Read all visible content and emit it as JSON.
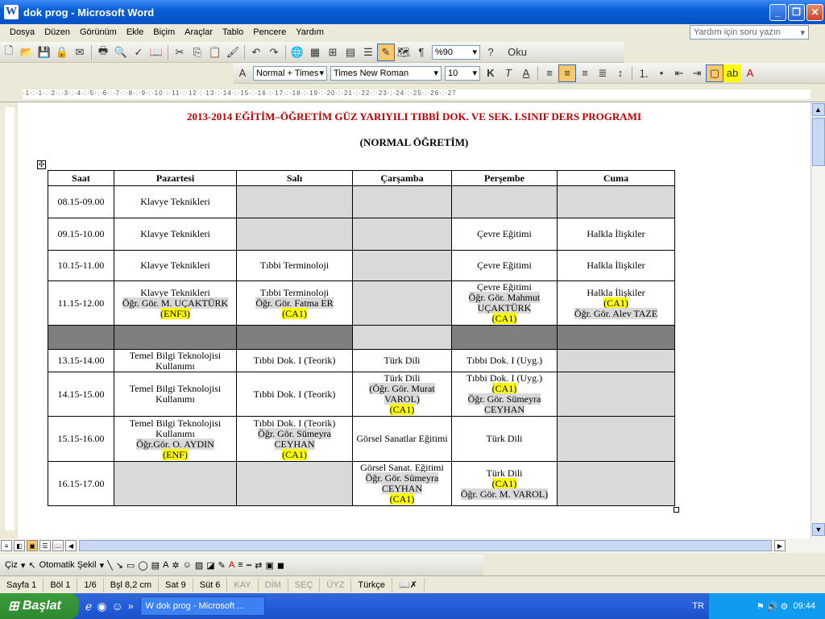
{
  "window": {
    "title": "dok prog - Microsoft Word",
    "icon_letter": "W"
  },
  "menu": [
    "Dosya",
    "Düzen",
    "Görünüm",
    "Ekle",
    "Biçim",
    "Araçlar",
    "Tablo",
    "Pencere",
    "Yardım"
  ],
  "help_placeholder": "Yardım için soru yazın",
  "toolbar": {
    "zoom": "%90",
    "read_label": "Oku",
    "style": "Normal + Times",
    "font": "Times New Roman",
    "size": "10"
  },
  "ruler_text": "·1·:·1·:·2·:·3·:·4·:·5·:·6·:·7·:·8·:·9·:·10·:·11·:·12·:·13·:·14·:·15·:·16·:·17·:·18·:·19·:·20·:·21·:·22·:·23·:·24·:·25·:·26·:·27",
  "document": {
    "title": "2013-2014 EĞİTİM–ÖĞRETİM GÜZ YARIYILI TIBBİ DOK. VE SEK. I.SINIF DERS PROGRAMI",
    "subtitle": "(NORMAL ÖĞRETİM)",
    "headers": [
      "Saat",
      "Pazartesi",
      "Salı",
      "Çarşamba",
      "Perşembe",
      "Cuma"
    ],
    "rows": [
      {
        "time": "08.15-09.00",
        "mon": "Klavye Teknikleri"
      },
      {
        "time": "09.15-10.00",
        "mon": "Klavye Teknikleri",
        "thu": "Çevre Eğitimi",
        "fri": "Halkla İlişkiler"
      },
      {
        "time": "10.15-11.00",
        "mon": "Klavye Teknikleri",
        "tue": "Tıbbi Terminoloji",
        "thu": "Çevre Eğitimi",
        "fri": "Halkla İlişkiler"
      },
      {
        "time": "11.15-12.00",
        "mon": {
          "l1": "Klavye Teknikleri",
          "l2": "Öğr. Gör. M. UÇAKTÜRK",
          "l3": "(ENF3)"
        },
        "tue": {
          "l1": "Tıbbi Terminoloji",
          "l2": "Öğr. Gör. Fatma ER",
          "l3": "(CA1)"
        },
        "thu": {
          "l1": "Çevre Eğitimi",
          "l2": "Öğr. Gör. Mahmut",
          "l3": "UÇAKTÜRK",
          "l4": "(CA1)"
        },
        "fri": {
          "l1": "Halkla İlişkiler",
          "l2": "(CA1)",
          "l3": "Öğr. Gör. Alev TAZE"
        }
      },
      {
        "time": "13.15-14.00",
        "mon": "Temel Bilgi Teknolojisi Kullanımı",
        "tue": "Tıbbi Dok. I  (Teorik)",
        "wed": "Türk Dili",
        "thu": "Tıbbi Dok. I  (Uyg.)"
      },
      {
        "time": "14.15-15.00",
        "mon": "Temel Bilgi Teknolojisi Kullanımı",
        "tue": "Tıbbi Dok. I (Teorik)",
        "wed": {
          "l1": "Türk Dili",
          "l2": "(Öğr. Gör. Murat",
          "l3": "VAROL)",
          "l4": "(CA1)"
        },
        "thu": {
          "l1": "Tıbbi Dok. I  (Uyg.)",
          "l2": "(CA1)",
          "l3": "Öğr. Gör.  Sümeyra",
          "l4": "CEYHAN"
        }
      },
      {
        "time": "15.15-16.00",
        "mon": {
          "l1": "Temel Bilgi Teknolojisi",
          "l2": "Kullanımı",
          "l3": "Öğr.Gör. O. AYDIN",
          "l4": "(ENF)"
        },
        "tue": {
          "l1": "Tıbbi Dok. I (Teorik)",
          "l2": "Öğr. Gör. Sümeyra",
          "l3": "CEYHAN",
          "l4": "(CA1)"
        },
        "wed": "Görsel Sanatlar Eğitimi",
        "thu": "Türk Dili"
      },
      {
        "time": "16.15-17.00",
        "wed": {
          "l1": "Görsel Sanat. Eğitimi",
          "l2": "Öğr. Gör. Sümeyra",
          "l3": "CEYHAN",
          "l4": "(CA1)"
        },
        "thu": {
          "l1": "Türk Dili",
          "l2": "(CA1)",
          "l3": "Öğr. Gör. M. VAROL)"
        }
      }
    ]
  },
  "drawing": {
    "draw_label": "Çiz",
    "autoshape_label": "Otomatik Şekil"
  },
  "status": {
    "page": "Sayfa  1",
    "section": "Böl  1",
    "pages": "1/6",
    "pos": "Bşl  8,2 cm",
    "line": "Sat  9",
    "col": "Süt  6",
    "rec": "KAY",
    "trk": "DİM",
    "ext": "SEÇ",
    "ovr": "ÜYZ",
    "lang": "Türkçe"
  },
  "taskbar": {
    "start": "Başlat",
    "task": "dok prog - Microsoft ...",
    "lang": "TR",
    "clock": "09:44"
  }
}
